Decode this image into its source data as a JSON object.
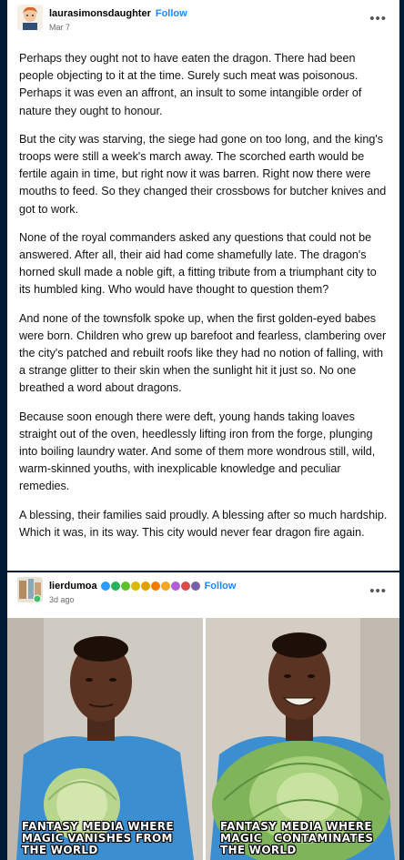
{
  "post1": {
    "username": "laurasimonsdaughter",
    "follow": "Follow",
    "date": "Mar 7",
    "more": "•••",
    "paragraphs": [
      "Perhaps they ought not to have eaten the dragon. There had been people objecting to it at the time. Surely such meat was poisonous. Perhaps it was even an affront, an insult to some intangible order of nature they ought to honour.",
      "But the city was starving, the siege had gone on too long, and the king's troops were still a week's march away. The scorched earth would be fertile again in time, but right now it was barren. Right now there were mouths to feed. So they changed their crossbows for butcher knives and got to work.",
      "None of the royal commanders asked any questions that could not be answered. After all, their aid had come shamefully late. The dragon's horned skull made a noble gift, a fitting tribute from a triumphant city to its humbled king. Who would have thought to question them?",
      "And none of the townsfolk spoke up, when the first golden-eyed babes were born. Children who grew up barefoot and fearless, clambering over the city's patched and rebuilt roofs like they had no notion of falling, with a strange glitter to their skin when the sunlight hit it just so. No one breathed a word about dragons.",
      "Because soon enough there were deft, young hands taking loaves straight out of the oven, heedlessly lifting iron from the forge, plunging into boiling laundry water. And some of them more wondrous still, wild, warm-skinned youths, with inexplicable knowledge and peculiar remedies.",
      "A blessing, their families said proudly. A blessing after so much hardship. Which it was, in its way. This city would never fear dragon fire again."
    ]
  },
  "post2": {
    "username": "lierdumoa",
    "follow": "Follow",
    "date": "3d ago",
    "more": "•••",
    "badge_colors": [
      "#2b9bff",
      "#27b35a",
      "#5fbf2a",
      "#d9b800",
      "#e0a100",
      "#f27a00",
      "#f5a623",
      "#b05fd6",
      "#d94b4b",
      "#7a5fa8"
    ],
    "meme_left": "FANTASY MEDIA WHERE\nMAGIC VANISHES FROM\nTHE WORLD",
    "meme_right": "FANTASY MEDIA WHERE\nMAGIC   CONTAMINATES\nTHE WORLD"
  }
}
